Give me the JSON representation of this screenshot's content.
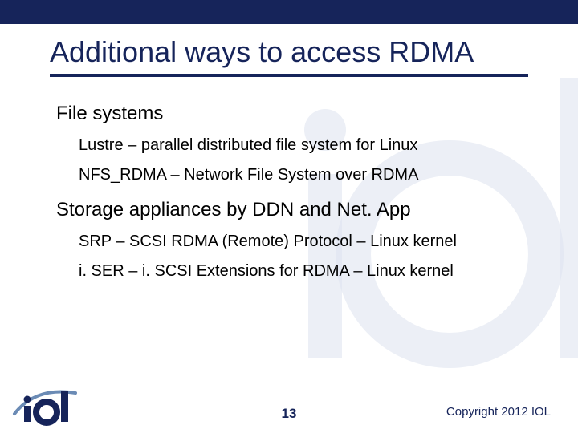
{
  "slide": {
    "title": "Additional ways to access RDMA",
    "page_number": "13",
    "copyright": "Copyright 2012 IOL"
  },
  "content": {
    "section1": {
      "heading": "File systems",
      "items": [
        "Lustre – parallel distributed file system for Linux",
        "NFS_RDMA – Network File System over RDMA"
      ]
    },
    "section2": {
      "heading": "Storage appliances by DDN and Net. App",
      "items": [
        "SRP – SCSI RDMA (Remote) Protocol – Linux kernel",
        "i. SER – i. SCSI Extensions for RDMA – Linux kernel"
      ]
    }
  },
  "brand": {
    "logo_text": "iol",
    "accent_color": "#16245a",
    "swoosh_color": "#6b8bb5"
  }
}
